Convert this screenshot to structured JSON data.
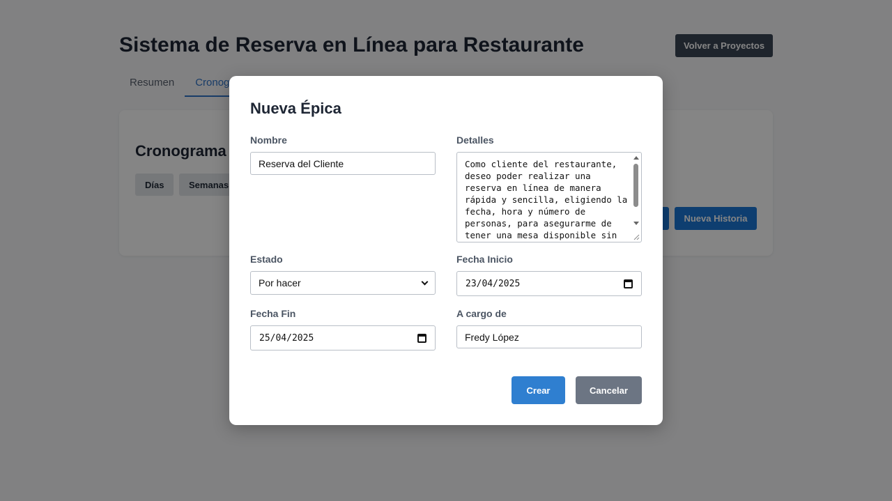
{
  "page": {
    "title": "Sistema de Reserva en Línea para Restaurante",
    "back_button": "Volver a Proyectos",
    "tabs": [
      {
        "label": "Resumen"
      },
      {
        "label": "Cronograma"
      }
    ],
    "card": {
      "title": "Cronograma",
      "view_buttons": [
        {
          "label": "Días"
        },
        {
          "label": "Semanas"
        }
      ],
      "new_story_button": "Nueva Historia"
    }
  },
  "modal": {
    "title": "Nueva Épica",
    "fields": {
      "nombre": {
        "label": "Nombre",
        "value": "Reserva del Cliente"
      },
      "detalles": {
        "label": "Detalles",
        "value": "Como cliente del restaurante, deseo poder realizar una reserva en línea de manera rápida y sencilla, eligiendo la fecha, hora y número de personas, para asegurarme de tener una mesa disponible sin"
      },
      "estado": {
        "label": "Estado",
        "value": "Por hacer"
      },
      "fecha_inicio": {
        "label": "Fecha Inicio",
        "value": "23/04/2025"
      },
      "fecha_fin": {
        "label": "Fecha Fin",
        "value": "25/04/2025"
      },
      "a_cargo": {
        "label": "A cargo de",
        "value": "Fredy López"
      }
    },
    "buttons": {
      "create": "Crear",
      "cancel": "Cancelar"
    }
  },
  "colors": {
    "primary": "#2f7fd0",
    "secondary": "#6c7583",
    "dark_button": "#3b4555",
    "tab_active": "#2f73c8",
    "overlay": "rgba(0,0,0,0.48)"
  }
}
